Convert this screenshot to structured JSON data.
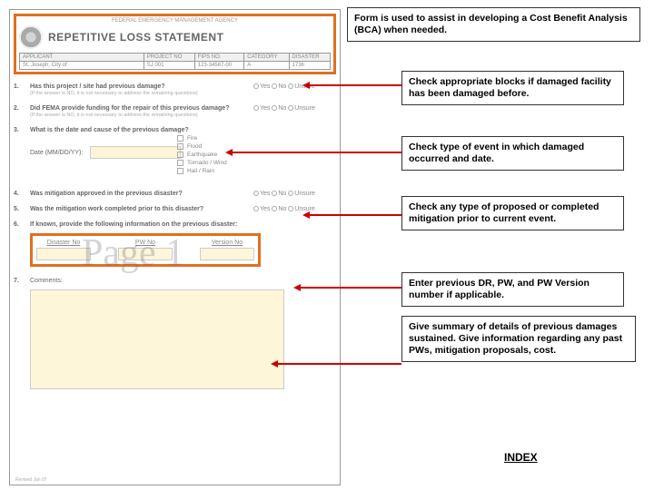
{
  "form": {
    "header_agency": "FEDERAL EMERGENCY MANAGEMENT AGENCY",
    "title": "REPETITIVE LOSS STATEMENT",
    "cols": {
      "applicant": "APPLICANT",
      "project_no": "PROJECT NO",
      "fips_no": "FIPS NO.",
      "category": "CATEGORY",
      "disaster": "DISASTER"
    },
    "vals": {
      "applicant": "St. Joseph, City of",
      "project_no": "SJ 001",
      "fips_no": "123-34567-00",
      "category": "A",
      "disaster": "1736"
    },
    "q1": {
      "num": "1.",
      "text": "Has this project / site had previous damage?",
      "hint": "(If the answer is NO, it is not necessary to address the remaining questions)"
    },
    "q2": {
      "num": "2.",
      "text": "Did FEMA provide funding for the repair of this previous damage?",
      "hint": "(If the answer is NO, it is not necessary to address the remaining questions)"
    },
    "q3": {
      "num": "3.",
      "text": "What is the date and cause of the previous damage?"
    },
    "q4": {
      "num": "4.",
      "text": "Was mitigation approved in the previous disaster?"
    },
    "q5": {
      "num": "5.",
      "text": "Was the mitigation work completed prior to this disaster?"
    },
    "q6": {
      "num": "6.",
      "text": "If known, provide the following information on the previous disaster:"
    },
    "q7": {
      "num": "7.",
      "text": "Comments:"
    },
    "date_label": "Date (MM/DD/YY):",
    "opts": {
      "yes": "Yes",
      "no": "No",
      "unsure": "Unsure"
    },
    "check": {
      "fire": "Fire",
      "flood": "Flood",
      "earthquake": "Earthquake",
      "tornado": "Tornado / Wind",
      "hail": "Hail / Rain"
    },
    "boxes": {
      "disaster_no": "Disaster No",
      "pw_no": "PW No",
      "version_no": "Version No"
    },
    "revised": "Revised Jan 07"
  },
  "watermark": "Page 1",
  "annotations": {
    "top": "Form is used to assist in developing a Cost Benefit Analysis (BCA) when needed.",
    "a1": "Check appropriate blocks if damaged facility has been damaged before.",
    "a2": "Check type of event in which damaged occurred and date.",
    "a3": "Check any type of proposed or completed mitigation prior to current event.",
    "a4": "Enter previous DR, PW, and PW Version number if applicable.",
    "a5": "Give summary of details of previous damages sustained.  Give information regarding any past PWs, mitigation proposals, cost."
  },
  "index_label": "INDEX"
}
